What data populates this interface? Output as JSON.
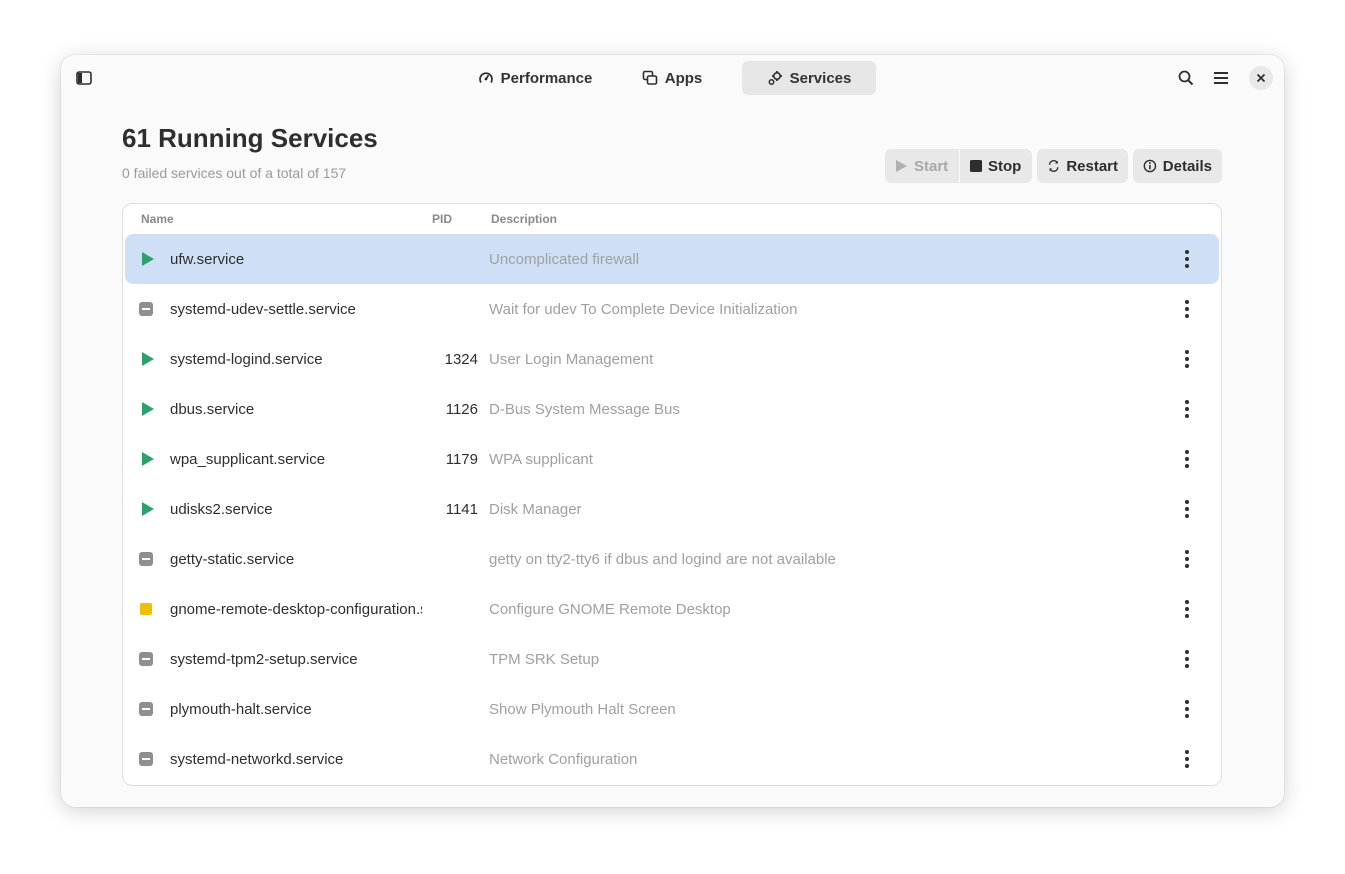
{
  "tabs": [
    {
      "label": "Performance",
      "icon": "performance-gauge-icon"
    },
    {
      "label": "Apps",
      "icon": "apps-windows-icon"
    },
    {
      "label": "Services",
      "icon": "services-gears-icon",
      "active": true
    }
  ],
  "header": {
    "title": "61 Running Services",
    "subtitle": "0 failed services out of a total of 157"
  },
  "actions": {
    "start": "Start",
    "stop": "Stop",
    "restart": "Restart",
    "details": "Details"
  },
  "columns": {
    "name": "Name",
    "pid": "PID",
    "description": "Description"
  },
  "services": [
    {
      "status": "running",
      "name": "ufw.service",
      "pid": "",
      "description": "Uncomplicated firewall",
      "selected": true
    },
    {
      "status": "stopped",
      "name": "systemd-udev-settle.service",
      "pid": "",
      "description": "Wait for udev To Complete Device Initialization"
    },
    {
      "status": "running",
      "name": "systemd-logind.service",
      "pid": "1324",
      "description": "User Login Management"
    },
    {
      "status": "running",
      "name": "dbus.service",
      "pid": "1126",
      "description": "D-Bus System Message Bus"
    },
    {
      "status": "running",
      "name": "wpa_supplicant.service",
      "pid": "1179",
      "description": "WPA supplicant"
    },
    {
      "status": "running",
      "name": "udisks2.service",
      "pid": "1141",
      "description": "Disk Manager"
    },
    {
      "status": "stopped",
      "name": "getty-static.service",
      "pid": "",
      "description": "getty on tty2-tty6 if dbus and logind are not available"
    },
    {
      "status": "warning",
      "name": "gnome-remote-desktop-configuration.service",
      "pid": "",
      "description": "Configure GNOME Remote Desktop"
    },
    {
      "status": "stopped",
      "name": "systemd-tpm2-setup.service",
      "pid": "",
      "description": "TPM SRK Setup"
    },
    {
      "status": "stopped",
      "name": "plymouth-halt.service",
      "pid": "",
      "description": "Show Plymouth Halt Screen"
    },
    {
      "status": "stopped",
      "name": "systemd-networkd.service",
      "pid": "",
      "description": "Network Configuration"
    }
  ],
  "colors": {
    "running": "#2ea06b",
    "stopped": "#8f8f8f",
    "warning": "#f0c000",
    "selected_row": "#cfe0f6"
  }
}
